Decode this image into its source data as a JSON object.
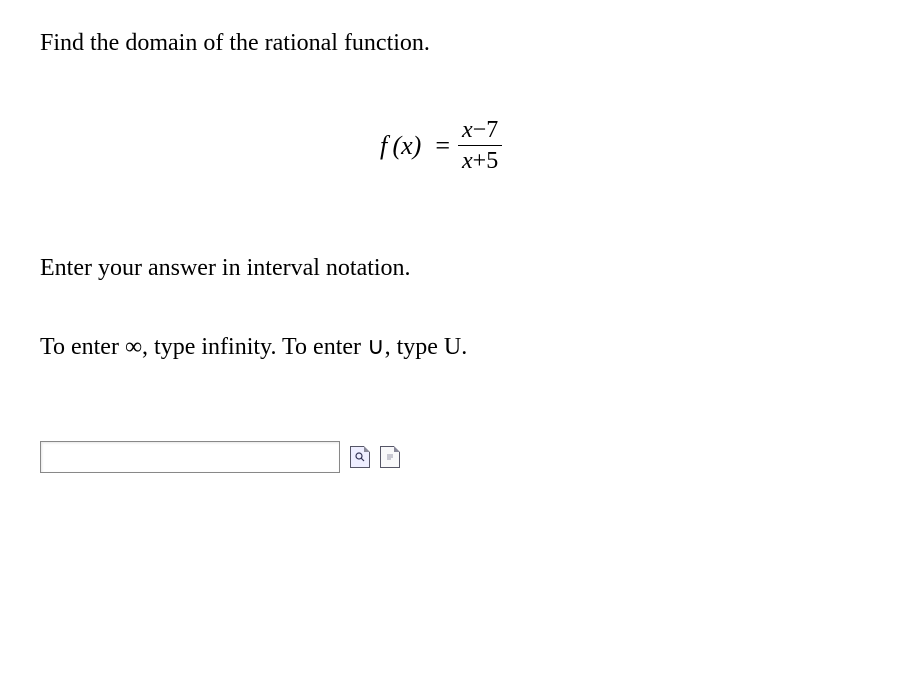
{
  "prompt": "Find the domain of the rational function.",
  "equation": {
    "lhs_func": "f",
    "lhs_arg": "x",
    "numerator_var": "x",
    "numerator_op_const": "−7",
    "denominator_var": "x",
    "denominator_op_const": "+5"
  },
  "instruction": "Enter your answer in interval notation.",
  "hint": "To enter ∞, type infinity. To enter ∪, type U.",
  "answer_value": "",
  "answer_placeholder": ""
}
